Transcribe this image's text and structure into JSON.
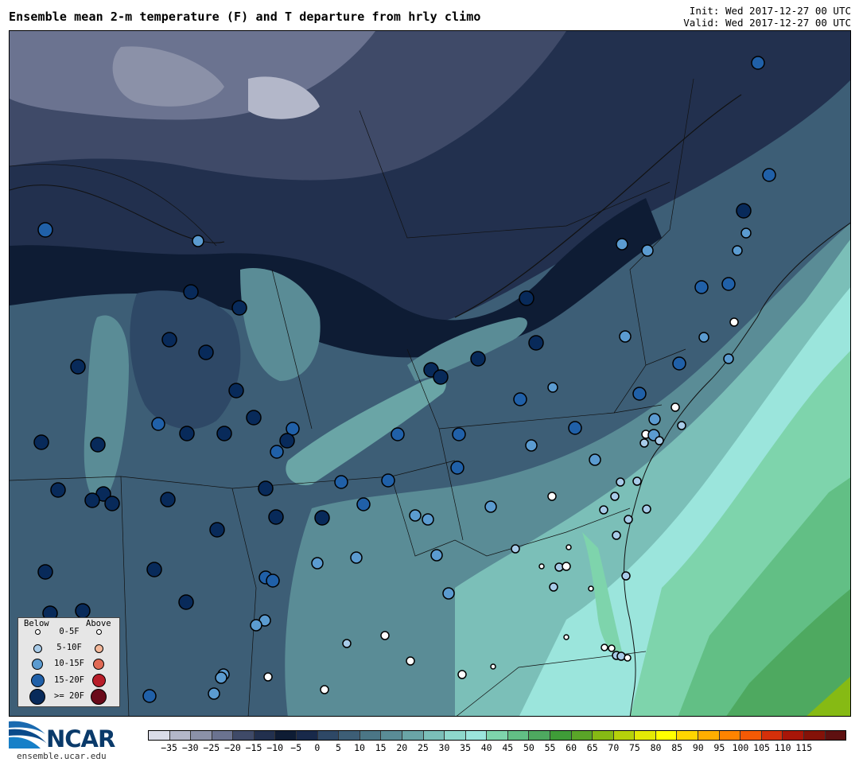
{
  "title": "Ensemble mean 2-m temperature (F) and T departure from hrly climo",
  "init": "Init: Wed 2017-12-27 00 UTC",
  "valid": "Valid: Wed 2017-12-27 00 UTC",
  "legend": {
    "below_label": "Below",
    "above_label": "Above",
    "rows": [
      "0-5F",
      "5-10F",
      "10-15F",
      "15-20F",
      ">= 20F"
    ],
    "below_colors": [
      "#ffffff",
      "#a8cbe8",
      "#5b9bd0",
      "#2060a8",
      "#082a5a"
    ],
    "above_colors": [
      "#ffffff",
      "#f4b89a",
      "#e06a55",
      "#b81e2a",
      "#6a0a1a"
    ]
  },
  "logo": {
    "name": "NCAR",
    "url": "ensemble.ucar.edu"
  },
  "colorbar": {
    "ticks": [
      "−35",
      "−30",
      "−25",
      "−20",
      "−15",
      "−10",
      "−5",
      "0",
      "5",
      "10",
      "15",
      "20",
      "25",
      "30",
      "35",
      "40",
      "45",
      "50",
      "55",
      "60",
      "65",
      "70",
      "75",
      "80",
      "85",
      "90",
      "95",
      "100",
      "105",
      "110",
      "115"
    ],
    "colors": [
      "#dadce8",
      "#b3b7c9",
      "#8b91a8",
      "#6b7390",
      "#3f4a68",
      "#22304e",
      "#0e1c34",
      "#18294a",
      "#2e4866",
      "#3d5e76",
      "#4b7686",
      "#5a8c96",
      "#6aa5a6",
      "#7bbfb8",
      "#8ed8cc",
      "#9be5dc",
      "#7ed4ac",
      "#62bf85",
      "#4ea960",
      "#3f9c38",
      "#5aa528",
      "#86ba14",
      "#b6d20a",
      "#e4ea05",
      "#ffff00",
      "#ffd500",
      "#ffae00",
      "#ff8400",
      "#f45a05",
      "#d4300a",
      "#a81608",
      "#841208",
      "#5e1010"
    ]
  }
}
